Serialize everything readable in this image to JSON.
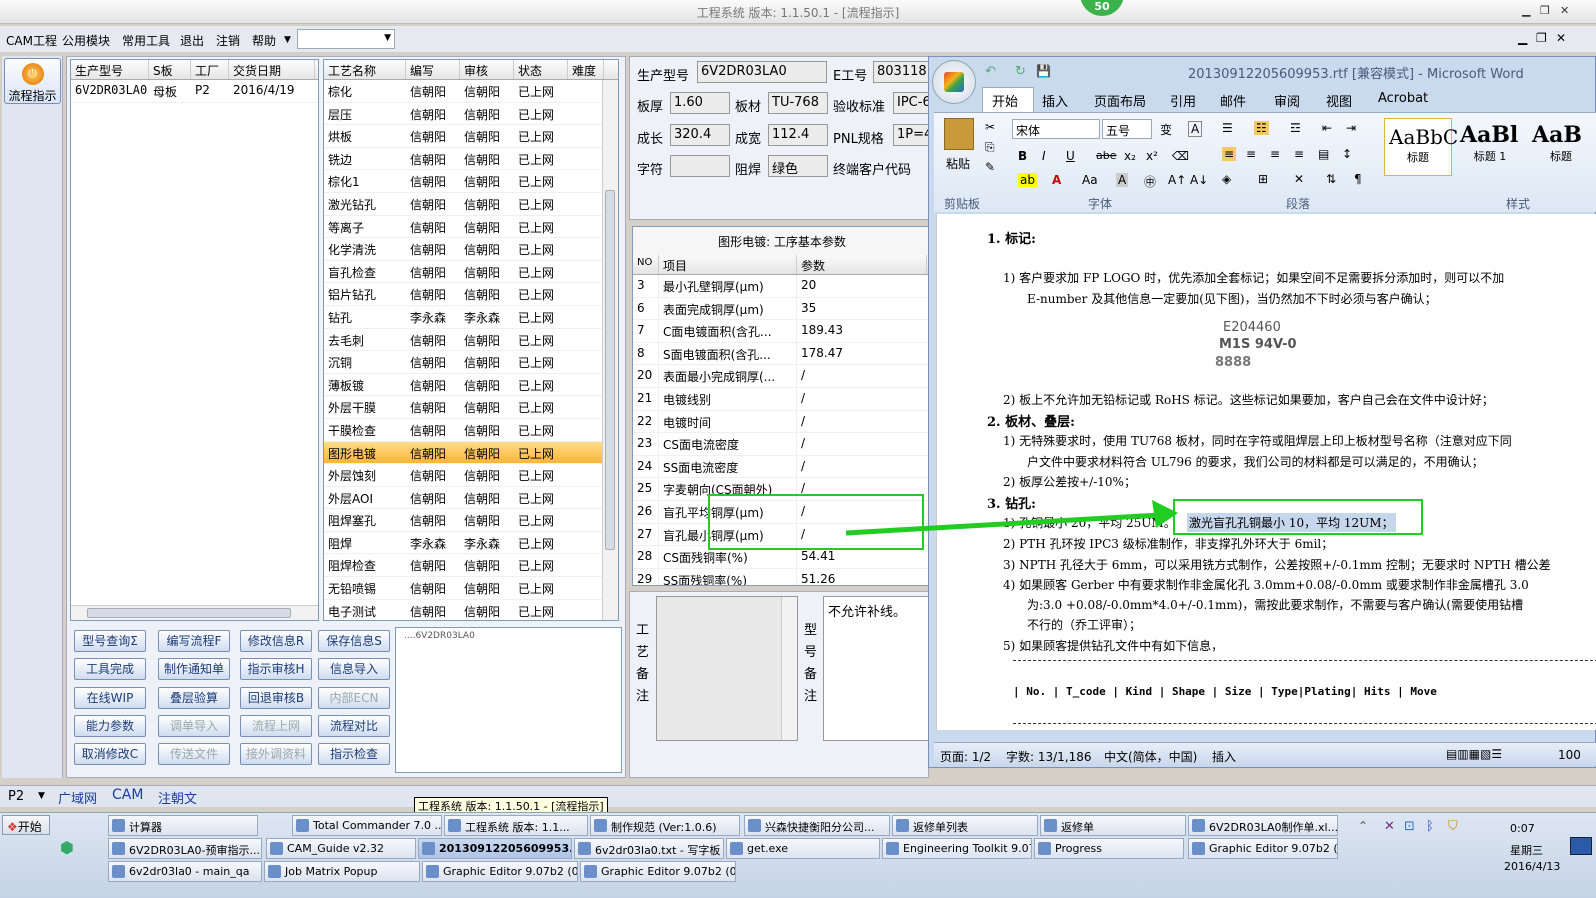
{
  "window": {
    "title": "工程系统  版本: 1.1.50.1 - [流程指示]",
    "badge": "50"
  },
  "menu": [
    "CAM工程",
    "公用模块",
    "常用工具",
    "退出",
    "注销",
    "帮助"
  ],
  "sidebar": {
    "button": "流程指示"
  },
  "product_table": {
    "headers": [
      "生产型号",
      "S板",
      "工厂",
      "交货日期"
    ],
    "row": [
      "6V2DR03LA0",
      "母板",
      "P2",
      "2016/4/19"
    ]
  },
  "process_table": {
    "headers": [
      "工艺名称",
      "编写",
      "审核",
      "状态",
      "难度"
    ],
    "rows": [
      [
        "棕化",
        "信朝阳",
        "信朝阳",
        "已上网"
      ],
      [
        "层压",
        "信朝阳",
        "信朝阳",
        "已上网"
      ],
      [
        "烘板",
        "信朝阳",
        "信朝阳",
        "已上网"
      ],
      [
        "铣边",
        "信朝阳",
        "信朝阳",
        "已上网"
      ],
      [
        "棕化1",
        "信朝阳",
        "信朝阳",
        "已上网"
      ],
      [
        "激光钻孔",
        "信朝阳",
        "信朝阳",
        "已上网"
      ],
      [
        "等离子",
        "信朝阳",
        "信朝阳",
        "已上网"
      ],
      [
        "化学清洗",
        "信朝阳",
        "信朝阳",
        "已上网"
      ],
      [
        "盲孔检查",
        "信朝阳",
        "信朝阳",
        "已上网"
      ],
      [
        "铝片钻孔",
        "信朝阳",
        "信朝阳",
        "已上网"
      ],
      [
        "钻孔",
        "李永森",
        "李永森",
        "已上网"
      ],
      [
        "去毛刺",
        "信朝阳",
        "信朝阳",
        "已上网"
      ],
      [
        "沉铜",
        "信朝阳",
        "信朝阳",
        "已上网"
      ],
      [
        "薄板镀",
        "信朝阳",
        "信朝阳",
        "已上网"
      ],
      [
        "外层干膜",
        "信朝阳",
        "信朝阳",
        "已上网"
      ],
      [
        "干膜检查",
        "信朝阳",
        "信朝阳",
        "已上网"
      ],
      [
        "图形电镀",
        "信朝阳",
        "信朝阳",
        "已上网"
      ],
      [
        "外层蚀刻",
        "信朝阳",
        "信朝阳",
        "已上网"
      ],
      [
        "外层AOI",
        "信朝阳",
        "信朝阳",
        "已上网"
      ],
      [
        "阻焊塞孔",
        "信朝阳",
        "信朝阳",
        "已上网"
      ],
      [
        "阻焊",
        "李永森",
        "李永森",
        "已上网"
      ],
      [
        "阻焊检查",
        "信朝阳",
        "信朝阳",
        "已上网"
      ],
      [
        "无铅喷锡",
        "信朝阳",
        "信朝阳",
        "已上网"
      ],
      [
        "电子测试",
        "信朝阳",
        "信朝阳",
        "已上网"
      ]
    ],
    "selected_index": 16
  },
  "buttons": [
    [
      "型号查询Σ",
      "编写流程F",
      "修改信息R",
      "保存信息S"
    ],
    [
      "工具完成",
      "制作通知单",
      "指示审核H",
      "信息导入"
    ],
    [
      "在线WIP",
      "叠层验算",
      "回退审核B",
      "内部ECN"
    ],
    [
      "能力参数",
      "调单导入",
      "流程上网",
      "流程对比"
    ],
    [
      "取消修改C",
      "传送文件",
      "接外调资料",
      "指示检查"
    ]
  ],
  "buttons_disabled": [
    "内部ECN",
    "调单导入",
    "流程上网",
    "传送文件",
    "接外调资料"
  ],
  "tree_text": "6V2DR03LA0",
  "info": {
    "model_label": "生产型号",
    "model": "6V2DR03LA0",
    "e_label": "E工号",
    "e_value": "803118",
    "thick_label": "板厚",
    "thick": "1.60",
    "mat_label": "板材",
    "mat": "TU-768",
    "std_label": "验收标准",
    "std": "IPC-6",
    "len_label": "成长",
    "len": "320.4",
    "wid_label": "成宽",
    "wid": "112.4",
    "pnl_label": "PNL规格",
    "pnl": "1P=4",
    "char_label": "字符",
    "char": "",
    "mask_label": "阻焊",
    "mask": "绿色",
    "cust_label": "终端客户代码",
    "cust": ""
  },
  "params": {
    "title": "图形电镀: 工序基本参数",
    "headers": [
      "NO",
      "项目",
      "参数"
    ],
    "rows": [
      [
        "3",
        "最小孔壁铜厚(μm)",
        "20"
      ],
      [
        "6",
        "表面完成铜厚(μm)",
        "35"
      ],
      [
        "7",
        "C面电镀面积(含孔...",
        "189.43"
      ],
      [
        "8",
        "S面电镀面积(含孔...",
        "178.47"
      ],
      [
        "20",
        "表面最小完成铜厚(...",
        "/"
      ],
      [
        "21",
        "电镀线别",
        "/"
      ],
      [
        "22",
        "电镀时间",
        "/"
      ],
      [
        "23",
        "CS面电流密度",
        "/"
      ],
      [
        "24",
        "SS面电流密度",
        "/"
      ],
      [
        "25",
        "字麦朝向(CS面朝外)",
        "/"
      ],
      [
        "26",
        "盲孔平均铜厚(μm)",
        "/"
      ],
      [
        "27",
        "盲孔最小铜厚(μm)",
        "/"
      ],
      [
        "28",
        "CS面残铜率(%)",
        "54.41"
      ],
      [
        "29",
        "SS面残铜率(%)",
        "51.26"
      ]
    ]
  },
  "notes": {
    "process_label": "工艺备注",
    "model_label": "型号备注",
    "model_text": "不允许补线。"
  },
  "statusbar": {
    "plant": "P2",
    "tabs": [
      "广域网",
      "CAM",
      "注朝文"
    ]
  },
  "word": {
    "title": "20130912205609953.rtf [兼容模式] - Microsoft Word",
    "tabs": [
      "开始",
      "插入",
      "页面布局",
      "引用",
      "邮件",
      "审阅",
      "视图",
      "Acrobat"
    ],
    "font": "宋体",
    "size": "五号",
    "groups": [
      "剪贴板",
      "字体",
      "段落",
      "样式"
    ],
    "paste": "粘贴",
    "styles": [
      [
        "AaBbC",
        "标题"
      ],
      [
        "AaBl",
        "标题 1"
      ],
      [
        "AaB",
        "标题"
      ]
    ],
    "status": {
      "page": "页面: 1/2",
      "words": "字数: 13/1,186",
      "lang": "中文(简体，中国)",
      "mode": "插入",
      "zoom": "100"
    },
    "doc": {
      "h1": "1.  标记:",
      "p1a": "1) 客户要求加 FP LOGO 时，优先添加全套标记；如果空间不足需要拆分添加时，则可以不加",
      "p1b": "E-number 及其他信息一定要加(见下图)，当仍然加不下时必须与客户确认；",
      "logo1": "E204460",
      "logo2": "M1S 94V-0",
      "logo3": "8888",
      "p2": "2) 板上不允许加无铅标记或 RoHS 标记。这些标记如果要加，客户自己会在文件中设计好；",
      "h2": "2.  板材、叠层:",
      "p3a": "1) 无特殊要求时，使用 TU768 板材，同时在字符或阻焊层上印上板材型号名称（注意对应下同",
      "p3b": "户文件中要求材料符合 UL796 的要求，我们公司的材料都是可以满足的，不用确认；",
      "p4": "2) 板厚公差按+/-10%；",
      "h3": "3.  钻孔:",
      "p5": "1) 孔铜最小 20，平均 25UM。",
      "hl": "激光盲孔孔铜最小 10，平均 12UM；",
      "p6": "2) PTH 孔环按 IPC3 级标准制作，非支撑孔外环大于 6mil；",
      "p7": "3) NPTH 孔径大于 6mm，可以采用铣方式制作，公差按照+/-0.1mm 控制；无要求时 NPTH 槽公差",
      "p8a": "4) 如果顾客 Gerber 中有要求制作非金属化孔 3.0mm+0.08/-0.0mm 或要求制作非金属槽孔 3.0",
      "p8b": "为:3.0 +0.08/-0.0mm*4.0+/-0.1mm)，需按此要求制作，不需要与客户确认(需要使用钻槽",
      "p8c": "不行的（乔工评审）；",
      "p9": "5) 如果顾客提供钻孔文件中有如下信息，",
      "th": "| No. | T_code  | Kind  | Shape |    Size   | Type|Plating|    Hits    |    Move"
    }
  },
  "taskbar": {
    "start": "开始",
    "clock": "0:07",
    "day": "星期三",
    "date": "2016/4/13",
    "items": [
      [
        "计算器",
        "Total Commander 7.0 ...",
        "工程系统  版本: 1.1...",
        "制作规范 (Ver:1.0.6)",
        "兴森快捷衡阳分公司...",
        "返修单列表",
        "返修单",
        "6V2DR03LA0制作单.xl..."
      ],
      [
        "6V2DR03LA0-预审指示...",
        "CAM_Guide v2.32",
        "20130912205609953...",
        "6v2dr03la0.txt - 写字板",
        "get.exe",
        "Engineering Toolkit 9.07...",
        "Progress",
        "Graphic Editor 9.07b2 (..."
      ],
      [
        "6v2dr03la0 - main_qa",
        "Job Matrix Popup",
        "Graphic Editor 9.07b2 (0...",
        "Graphic Editor 9.07b2 (0..."
      ]
    ]
  },
  "colors": {
    "highlight": "#f6b740",
    "arrow": "#22cc22",
    "selection": "#c6d6ec"
  }
}
